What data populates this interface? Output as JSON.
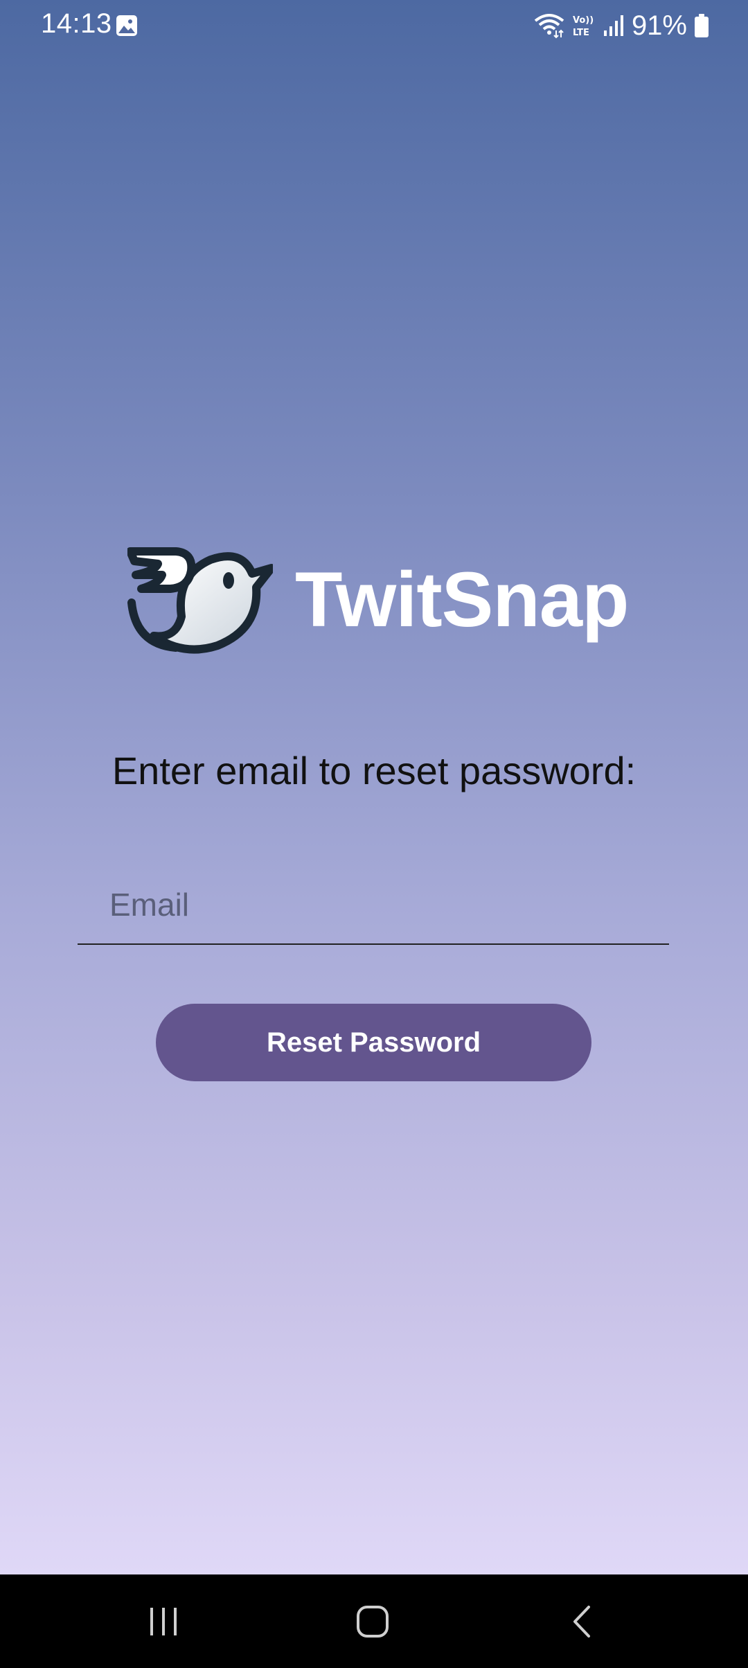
{
  "status_bar": {
    "time": "14:13",
    "battery": "91%",
    "icons": [
      "gallery-icon",
      "wifi-icon",
      "volte-icon",
      "signal-icon",
      "battery-icon"
    ]
  },
  "app": {
    "title": "TwitSnap",
    "logo_icon": "bird-logo-icon"
  },
  "reset": {
    "prompt": "Enter email to reset password:",
    "email_placeholder": "Email",
    "email_value": "",
    "button_label": "Reset Password"
  },
  "nav_bar": {
    "icons": [
      "recent-apps-icon",
      "home-icon",
      "back-icon"
    ]
  },
  "colors": {
    "gradient_top": "#4d69a2",
    "gradient_bottom": "#e7dffc",
    "button": "#63558e",
    "title": "#ffffff"
  }
}
